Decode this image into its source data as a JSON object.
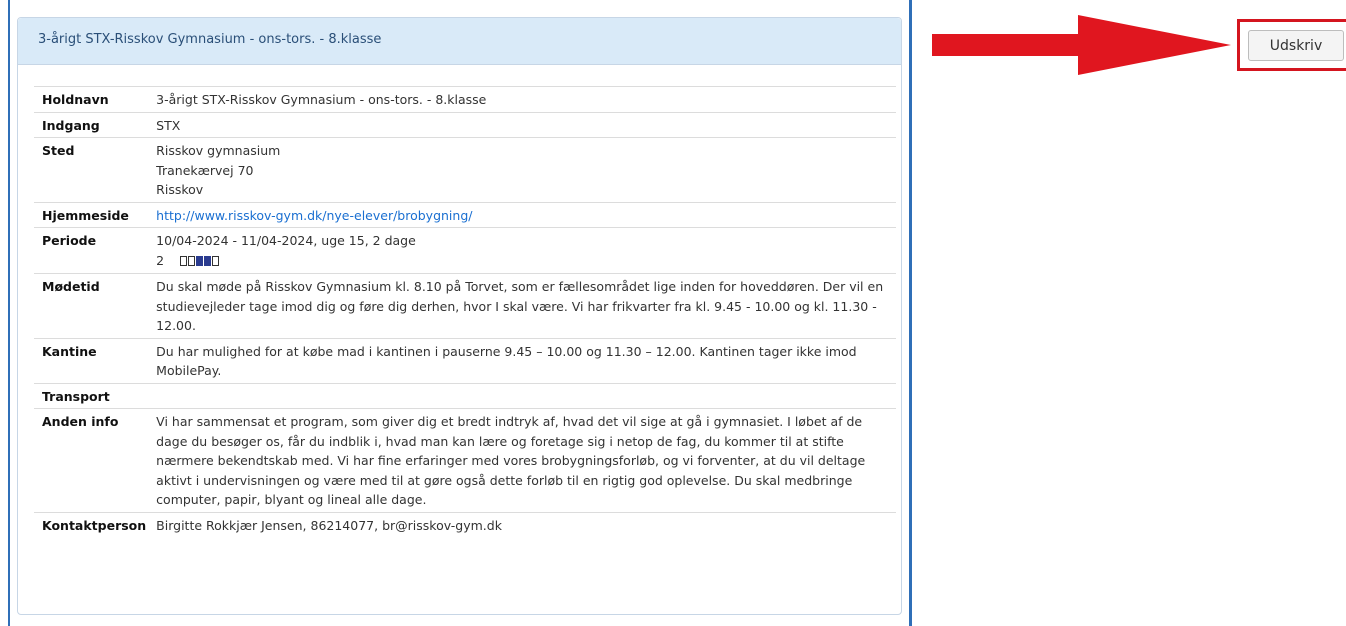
{
  "panel": {
    "heading": "3-årigt STX-Risskov Gymnasium - ons-tors. - 8.klasse"
  },
  "details": {
    "holdnavn": {
      "label": "Holdnavn",
      "value": "3-årigt STX-Risskov Gymnasium - ons-tors. - 8.klasse"
    },
    "indgang": {
      "label": "Indgang",
      "value": "STX"
    },
    "sted": {
      "label": "Sted",
      "lines": [
        "Risskov gymnasium",
        "Tranekærvej 70",
        "Risskov"
      ]
    },
    "hjemmeside": {
      "label": "Hjemmeside",
      "value": "http://www.risskov-gym.dk/nye-elever/brobygning/"
    },
    "periode": {
      "label": "Periode",
      "value": "10/04-2024 - 11/04-2024, uge 15, 2 dage",
      "week_count": "2",
      "boxes_filled": [
        false,
        false,
        true,
        true,
        false
      ]
    },
    "modetid": {
      "label": "Mødetid",
      "value": "Du skal møde på Risskov Gymnasium kl. 8.10 på Torvet, som er fællesområdet lige inden for hoveddøren. Der vil en studievejleder tage imod dig og føre dig derhen, hvor I skal være. Vi har frikvarter fra kl. 9.45 - 10.00 og kl. 11.30 - 12.00."
    },
    "kantine": {
      "label": "Kantine",
      "value": "Du har mulighed for at købe mad i kantinen i pauserne 9.45 – 10.00 og 11.30 – 12.00. Kantinen tager ikke imod MobilePay."
    },
    "transport": {
      "label": "Transport",
      "value": ""
    },
    "anden_info": {
      "label": "Anden info",
      "value": "Vi har sammensat et program, som giver dig et bredt indtryk af, hvad det vil sige at gå i gymnasiet. I løbet af de dage du besøger os, får du indblik i, hvad man kan lære og foretage sig i netop de fag, du kommer til at stifte nærmere bekendtskab med. Vi har fine erfaringer med vores brobygningsforløb, og vi forventer, at du vil deltage aktivt i undervisningen og være med til at gøre også dette forløb til en rigtig god oplevelse. Du skal medbringe computer, papir, blyant og lineal alle dage."
    },
    "kontaktperson": {
      "label": "Kontaktperson",
      "value": "Birgitte Rokkjær Jensen, 86214077, br@risskov-gym.dk"
    }
  },
  "toolbar": {
    "print_label": "Udskriv"
  },
  "annotation": {
    "arrow_color": "#e0161f",
    "highlight_color": "#d4151f"
  }
}
